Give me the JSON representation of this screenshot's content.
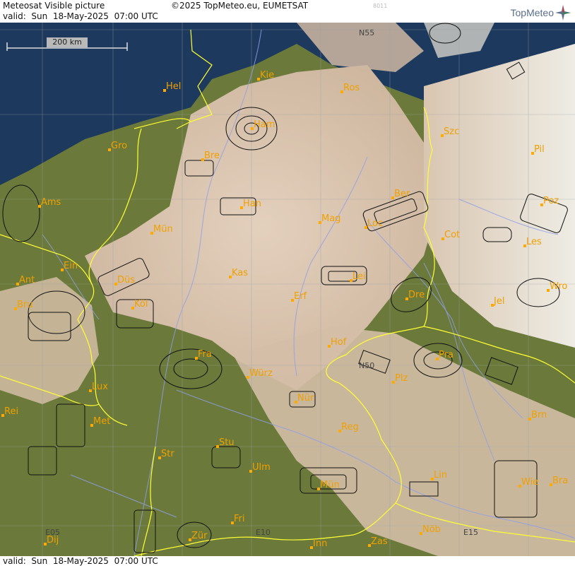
{
  "header": {
    "title": "Meteosat Visible picture",
    "copyright": "©2025 TopMeteo.eu, EUMETSAT",
    "valid": "valid:  Sun  18-May-2025  07:00 UTC",
    "code": "8011",
    "logo_text": "TopMeteo",
    "logo_icon": "compass-star-icon"
  },
  "footer": {
    "valid": "valid:  Sun  18-May-2025  07:00 UTC"
  },
  "scale": {
    "label": "200 km"
  },
  "grid_labels": [
    "N55",
    "N50",
    "E05",
    "E10",
    "E15"
  ],
  "cities": [
    "Kie",
    "Hel",
    "Ros",
    "Ham",
    "Szc",
    "Gro",
    "Bre",
    "Pil",
    "Ams",
    "Han",
    "Ber",
    "Poz",
    "Mag",
    "Loc",
    "Mün",
    "Cot",
    "Les",
    "Ein",
    "Kas",
    "Lei",
    "Ant",
    "Düs",
    "Dre",
    "Wro",
    "Bru",
    "Köl",
    "Erf",
    "Jel",
    "Hof",
    "Fra",
    "Pra",
    "Würz",
    "Lux",
    "Plz",
    "Nür",
    "Rei",
    "Met",
    "Reg",
    "Brn",
    "Stu",
    "Str",
    "Ulm",
    "Lin",
    "Mün",
    "Wie",
    "Bra",
    "Fri",
    "Dij",
    "Zür",
    "Inn",
    "Zas",
    "Nöb"
  ],
  "colors": {
    "sea": "#1d3a5e",
    "land": "#6b7a3a",
    "cloud": "#d8c4ae",
    "border": "#ffff33",
    "river": "#8f9fe8",
    "city": "#f0a000"
  }
}
